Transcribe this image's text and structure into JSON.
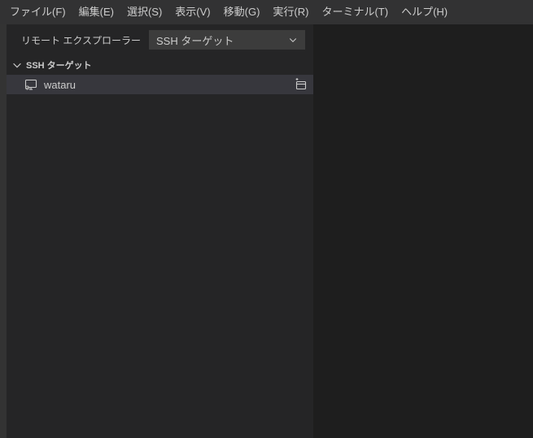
{
  "menubar": {
    "items": [
      {
        "label": "ファイル(F)"
      },
      {
        "label": "編集(E)"
      },
      {
        "label": "選択(S)"
      },
      {
        "label": "表示(V)"
      },
      {
        "label": "移動(G)"
      },
      {
        "label": "実行(R)"
      },
      {
        "label": "ターミナル(T)"
      },
      {
        "label": "ヘルプ(H)"
      }
    ]
  },
  "explorer": {
    "label": "リモート エクスプローラー",
    "dropdown_selected": "SSH ターゲット"
  },
  "section": {
    "title": "SSH ターゲット"
  },
  "targets": [
    {
      "name": "wataru"
    }
  ]
}
